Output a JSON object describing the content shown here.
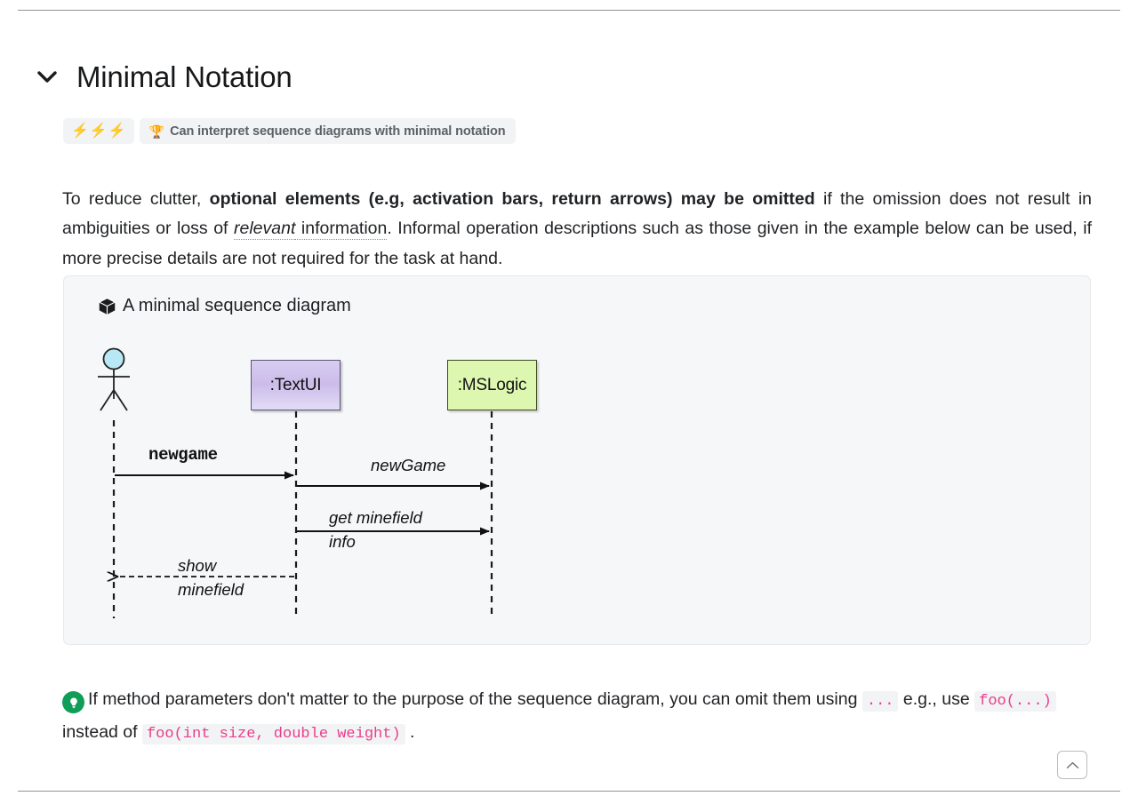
{
  "heading": {
    "toggle_icon": "chevron-down-icon",
    "title": "Minimal Notation"
  },
  "badge": {
    "level_icon": "lightning-bolt-icon",
    "level_bolts": 3,
    "outcome_icon": "trophy-icon",
    "outcome_text": "Can interpret sequence diagrams with minimal notation",
    "bolt_color": "#2f86f6",
    "background": "#f1f3f5"
  },
  "paragraph": {
    "seg1": "To reduce clutter, ",
    "bold1": "optional elements (e.g, activation bars, return arrows) may be omitted",
    "seg2": " if the omission does not result in ambiguities or loss of ",
    "tooltip_term": "relevant",
    "tooltip_tail": " information",
    "seg3": ". Informal operation descriptions such as those given in the example below can be used, if more precise details are not required for the task at hand."
  },
  "diagram_card": {
    "icon": "cube-icon",
    "title": "A minimal sequence diagram",
    "background": "#f6f7f8",
    "participants": [
      {
        "kind": "actor",
        "label": "",
        "head_color": "#b8e8f5"
      },
      {
        "kind": "object",
        "label": ":TextUI",
        "fill": "#cbbcea",
        "border": "#5c5580"
      },
      {
        "kind": "object",
        "label": ":MSLogic",
        "fill": "#ddf7b0",
        "border": "#3d4a1e"
      }
    ],
    "messages": [
      {
        "label": "newgame",
        "style": "mono-bold",
        "from": "actor",
        "to": "textui",
        "arrow": "solid"
      },
      {
        "label": "newGame",
        "style": "italic",
        "from": "textui",
        "to": "mslogic",
        "arrow": "solid"
      },
      {
        "label_line1": "get minefield",
        "label_line2": "info",
        "style": "italic",
        "from": "textui",
        "to": "mslogic",
        "arrow": "solid"
      },
      {
        "label_line1": "show",
        "label_line2": "minefield",
        "style": "italic",
        "from": "textui",
        "to": "actor",
        "arrow": "dashed-return"
      }
    ]
  },
  "tip": {
    "icon": "lightbulb-icon",
    "icon_color": "#0f9d58",
    "text1": "If method parameters don't matter to the purpose of the sequence diagram, you can omit them using ",
    "code1": "...",
    "text2": " e.g., use ",
    "code2": "foo(...)",
    "text3": " instead of ",
    "code3": "foo(int size, double weight)",
    "text4": " .",
    "code_color": "#e83e8c"
  },
  "back_to_top": {
    "icon": "chevron-up-icon",
    "label": ""
  }
}
